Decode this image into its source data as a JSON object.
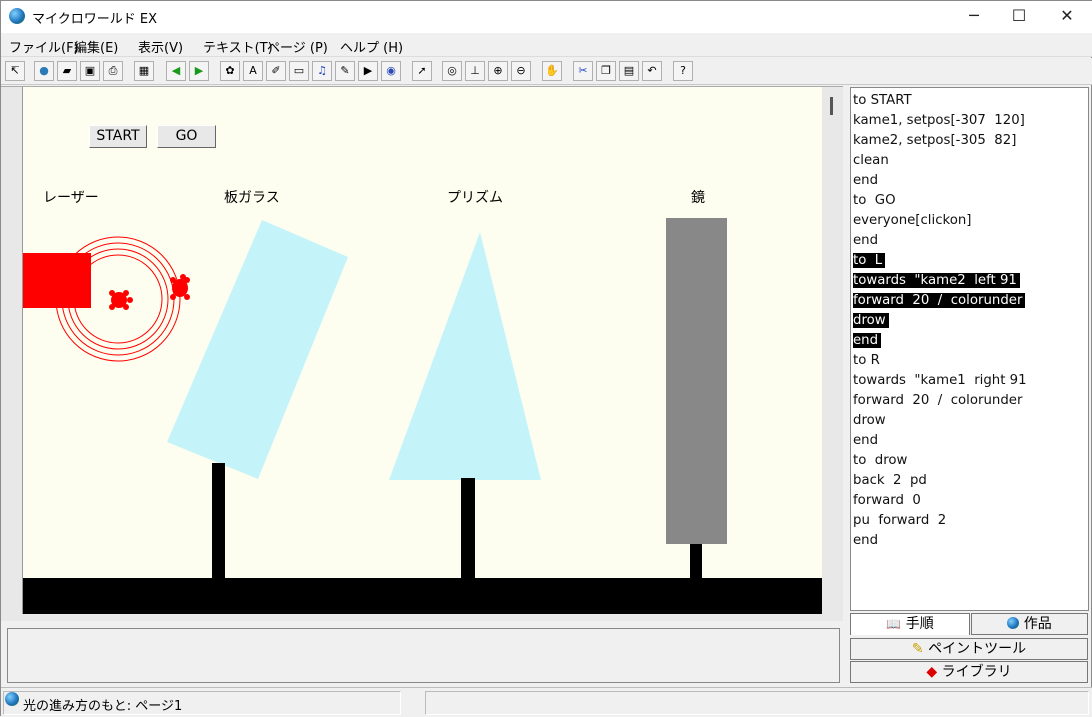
{
  "window": {
    "title": "マイクロワールド EX"
  },
  "window_controls": {
    "minimize": "─",
    "maximize": "☐",
    "close": "✕"
  },
  "menu": [
    "ファイル(F)",
    "編集(E)",
    "表示(V)",
    "テキスト(T)",
    "ページ (P)",
    "ヘルプ (H)"
  ],
  "toolbar": [
    "arrow-select-icon",
    "globe-icon",
    "open-folder-icon",
    "save-icon",
    "print-icon",
    "pages-icon",
    "back-arrow-icon",
    "forward-arrow-icon",
    "turtle-hatch-icon",
    "text-box-icon",
    "brush-icon",
    "button-icon",
    "music-icon",
    "pencil-icon",
    "video-icon",
    "record-icon",
    "pointer-icon",
    "eye-icon",
    "stamp-icon",
    "zoom-in-icon",
    "zoom-out-icon",
    "stop-hand-icon",
    "cut-icon",
    "copy-icon",
    "paste-icon",
    "undo-icon",
    "help-icon"
  ],
  "canvas": {
    "buttons": {
      "start": "START",
      "go": "GO"
    },
    "labels": {
      "laser": "レーザー",
      "glass": "板ガラス",
      "prism": "プリズム",
      "mirror": "鏡"
    },
    "colors": {
      "background": "#fefef0",
      "laser": "#ff0000",
      "glass": "#c4f4fa",
      "mirror": "#888888",
      "ground": "#000000"
    }
  },
  "code": {
    "lines": [
      {
        "text": "to START",
        "hl": false
      },
      {
        "text": "kame1, setpos[-307  120]",
        "hl": false
      },
      {
        "text": "kame2, setpos[-305  82]",
        "hl": false
      },
      {
        "text": "clean",
        "hl": false
      },
      {
        "text": "end",
        "hl": false
      },
      {
        "text": "to  GO",
        "hl": false
      },
      {
        "text": "everyone[clickon]",
        "hl": false
      },
      {
        "text": "end",
        "hl": false
      },
      {
        "text": "to  L",
        "hl": true
      },
      {
        "text": "towards  \"kame2  left 91",
        "hl": true
      },
      {
        "text": "forward  20  /  colorunder",
        "hl": true
      },
      {
        "text": "drow",
        "hl": true
      },
      {
        "text": "end",
        "hl": true
      },
      {
        "text": "to R",
        "hl": false
      },
      {
        "text": "towards  \"kame1  right 91",
        "hl": false
      },
      {
        "text": "forward  20  /  colorunder",
        "hl": false
      },
      {
        "text": "drow",
        "hl": false
      },
      {
        "text": "end",
        "hl": false
      },
      {
        "text": "to  drow",
        "hl": false
      },
      {
        "text": "back  2  pd",
        "hl": false
      },
      {
        "text": "forward  0",
        "hl": false
      },
      {
        "text": "pu  forward  2",
        "hl": false
      },
      {
        "text": "end",
        "hl": false
      }
    ]
  },
  "tabs": {
    "procedures": "手順",
    "project": "作品",
    "paint": "ペイントツール",
    "library": "ライブラリ"
  },
  "status": {
    "text": "光の進み方のもと: ページ1"
  }
}
